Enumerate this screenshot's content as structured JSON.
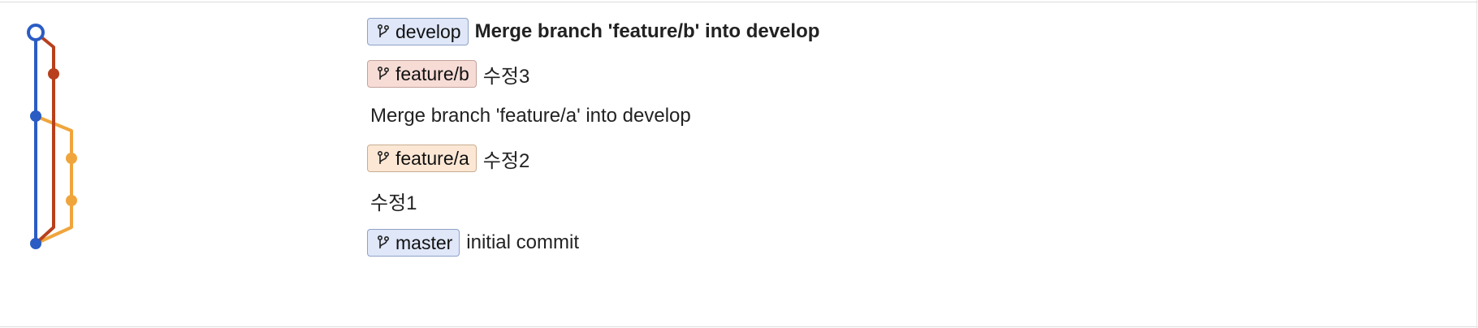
{
  "colors": {
    "develop": "#2a5cc4",
    "feature_b": "#b8401c",
    "feature_a": "#f0a53c",
    "ref_blue_bg": "#dfe7f8",
    "ref_red_bg": "#f7dcd6",
    "ref_orange_bg": "#fbe7d4"
  },
  "commits": [
    {
      "ref": "develop",
      "ref_color": "blue",
      "message": "Merge branch 'feature/b' into develop",
      "bold": true
    },
    {
      "ref": "feature/b",
      "ref_color": "red",
      "message": "수정3"
    },
    {
      "ref": "",
      "ref_color": "",
      "message": "Merge branch 'feature/a' into develop"
    },
    {
      "ref": "feature/a",
      "ref_color": "orange",
      "message": "수정2"
    },
    {
      "ref": "",
      "ref_color": "",
      "message": "수정1"
    },
    {
      "ref": "master",
      "ref_color": "blue",
      "message": "initial commit"
    }
  ],
  "ref_icon": "git-branch-icon"
}
